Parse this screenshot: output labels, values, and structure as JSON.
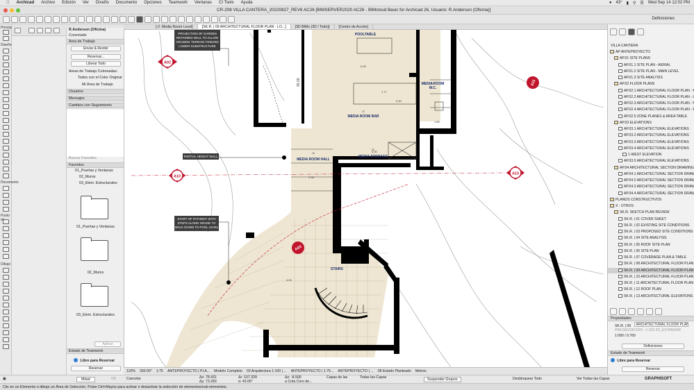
{
  "menubar": {
    "app": "Archicad",
    "items": [
      "Archivo",
      "Edición",
      "Ver",
      "Diseño",
      "Documento",
      "Opciones",
      "Teamwork",
      "Ventanas",
      "CI Tools",
      "Ayuda"
    ],
    "temp": "43°",
    "clock": "Wed Sep 14  12:02 PM"
  },
  "window": {
    "title": "CR-208 VILLA CANTERA_20220827_REV6 AC26 [BIMSERVER2020 AC26 - BIMcloud Basic for Archicad 26, Usuario: R.Anderson (Oficina)]"
  },
  "toolbar": {
    "definiciones": "Definiciones"
  },
  "toolbox": {
    "label_top": "Principal:",
    "label_design": "Diseño",
    "label_doc": "Documento",
    "label_punto": "Punto de",
    "label_dibujo": "Dibujo"
  },
  "tabs": [
    "[-2. Media Room Level]",
    "[SK.R. | 09 ARCHITECTURAL FLOOR PLAN - LO...]",
    "[3D BIMx (3D / Todo)]",
    "[Centro de Acción]"
  ],
  "teamwork": {
    "user": "R.Anderson (Oficina)",
    "connected": "Conectado",
    "area_trabajo": "Área de Trabajo",
    "send_receive": "Enviar & Recibir",
    "reserve": "Reservar...",
    "release_all": "Liberar Todo",
    "colored_areas": "Áreas de Trabajo Coloreadas:",
    "all_original": "Todos con el Color Original",
    "my_area": "Mi Área de Trabajo",
    "users": "Usuarios",
    "messages": "Mensajes",
    "changes": "Cambios con Seguimiento",
    "search": "Buscar Favoritos",
    "favorites": "Favoritos",
    "fav_items": [
      "01_Puertas y Ventanas",
      "02_Muros",
      "03_Elem. Estructurales"
    ],
    "folders": [
      "01_Puertas y Ventanas",
      "02_Muros",
      "03_Elem. Estructurales"
    ],
    "apply": "Aplicar",
    "status_head": "Estado de Teamwork",
    "free": "Libre para Reservar",
    "reserve_btn": "Reservar"
  },
  "plan": {
    "notes": [
      "PROJECTION OF GARDEN RETAINING WALL TO ALLOW GRADING TERRAIN TOWARD LOWER SUBSTRUCTURE",
      "PARTIAL HEIGHT WALL",
      "START OF PATHWAY WITH STEPS ALONG GRADE TO WALK DOWN TO POOL LEVEL"
    ],
    "rooms": [
      {
        "label": "POOLTABLE"
      },
      {
        "number": "20",
        "label": "MEDIA ROOM BAR"
      },
      {
        "number": "21",
        "label": "MEDIA ROOM",
        "sub": "W.C."
      },
      {
        "number": "26",
        "label": "MEDIA ROOM HALL"
      },
      {
        "number": "25",
        "label": "MEDIA STORAGE"
      },
      {
        "label": "STAIRS"
      }
    ],
    "section_markers": [
      "A02",
      "A11",
      "A10",
      "A10",
      "A03"
    ],
    "dims": [
      "6.25",
      "45.00",
      "1.77",
      "0.20",
      "1.80",
      "3.00",
      "2.36",
      "4.00"
    ]
  },
  "navigator": {
    "project": "VILLA CANTERA",
    "items": [
      {
        "t": "AP ANTEPROYECTO",
        "l": 0,
        "k": "folder"
      },
      {
        "t": "AP.01 SITE PLANS",
        "l": 1,
        "k": "folder"
      },
      {
        "t": "AP.01.1 SITE PLAN - AERIAL",
        "l": 2,
        "k": "view"
      },
      {
        "t": "AP.01.2 SITE PLAN - MAIN LEVEL",
        "l": 2,
        "k": "view"
      },
      {
        "t": "AP.01.3 SITE ANALYSIS",
        "l": 2,
        "k": "view"
      },
      {
        "t": "AP.02 FLOOR PLANS",
        "l": 1,
        "k": "folder"
      },
      {
        "t": "AP.02.1 ARCHITECTURAL FLOOR PLAN - MAIN LEVEL",
        "l": 2,
        "k": "view"
      },
      {
        "t": "AP.02.2 ARCHITECTURAL FLOOR PLAN - LOWER LEV",
        "l": 2,
        "k": "view"
      },
      {
        "t": "AP.02.3 ARCHITECTURAL FLOOR PLAN - MEDIA ROOM",
        "l": 2,
        "k": "view"
      },
      {
        "t": "AP.02.4 ARCHITECTURAL FLOOR PLAN - POOL & FAC",
        "l": 2,
        "k": "view"
      },
      {
        "t": "AP.02.5 ZONE PLANES & AREA TABLE",
        "l": 2,
        "k": "view"
      },
      {
        "t": "AP.03 ELEVATIONS",
        "l": 1,
        "k": "folder"
      },
      {
        "t": "AP.03.1 ARCHITECTURAL ELEVATIONS",
        "l": 2,
        "k": "view"
      },
      {
        "t": "AP.03.2 ARCHITECTURAL ELEVATIONS",
        "l": 2,
        "k": "view"
      },
      {
        "t": "AP.03.3 ARCHITECTURAL ELEVATIONS",
        "l": 2,
        "k": "view"
      },
      {
        "t": "AP.03.4 ARCHITECTURAL ELEVATIONS",
        "l": 2,
        "k": "view"
      },
      {
        "t": "1-WEST ELEVATION",
        "l": 3,
        "k": "view"
      },
      {
        "t": "AP.03.5 ARCHITECTURAL ELEVATIONS",
        "l": 2,
        "k": "view"
      },
      {
        "t": "AP.04 ARCHITECTURAL SECTION DRAWINGS",
        "l": 1,
        "k": "folder"
      },
      {
        "t": "AP.04.1 ARCHITECTURAL SECTION DRAWINGS",
        "l": 2,
        "k": "view"
      },
      {
        "t": "AP.04.2 ARCHITECTURAL SECTION DRAWINGS",
        "l": 2,
        "k": "view"
      },
      {
        "t": "AP.04.3 ARCHITECTURAL SECTION DRAWINGS",
        "l": 2,
        "k": "view"
      },
      {
        "t": "AP.04.4 ARCHITECTURAL SECTION DRAWINGS",
        "l": 2,
        "k": "view"
      },
      {
        "t": "PLANOS CONSTRUCTIVOS",
        "l": 0,
        "k": "folder"
      },
      {
        "t": "X - OTROS",
        "l": 0,
        "k": "folder"
      },
      {
        "t": "SK.R. SKETCH PLAN REVIEW",
        "l": 1,
        "k": "folder"
      },
      {
        "t": "SK.R. | 01 COVER SHEET",
        "l": 2,
        "k": "view"
      },
      {
        "t": "SK.R. | 02 EXISTING SITE CONDITIONS",
        "l": 2,
        "k": "view"
      },
      {
        "t": "SK.R. | 03 PROPOSED SITE CONDITIONS",
        "l": 2,
        "k": "view"
      },
      {
        "t": "SK.R. | 04 SITE ANALYSIS",
        "l": 2,
        "k": "view"
      },
      {
        "t": "SK.R. | 05 ROOF SITE PLAN",
        "l": 2,
        "k": "view"
      },
      {
        "t": "SK.R. | 06 SITE PLAN",
        "l": 2,
        "k": "view"
      },
      {
        "t": "SK.R. | 07 COVERAGE PLAN & TABLE",
        "l": 2,
        "k": "view"
      },
      {
        "t": "SK.R. | 08 ARCHITECTURAL FLOOR PLAN - MAIN LE",
        "l": 2,
        "k": "view"
      },
      {
        "t": "SK.R. | 09 ARCHITECTURAL FLOOR PLAN - LOWER",
        "l": 2,
        "k": "view",
        "sel": true
      },
      {
        "t": "SK.R. | 10 ARCHITECTURAL FLOOR PLAN - MEDIA",
        "l": 2,
        "k": "view"
      },
      {
        "t": "SK.R. | 11 ARCHITECTURAL FLOOR PLAN - POOL &",
        "l": 2,
        "k": "view"
      },
      {
        "t": "SK.R. | 12 ROOF PLAN",
        "l": 2,
        "k": "view"
      },
      {
        "t": "SK.R. | 13 ARCHITECTURAL ELEVATIONS",
        "l": 2,
        "k": "view"
      }
    ],
    "props_head": "Propiedades",
    "prop_id": "SK.R. | 09",
    "prop_name": "ARCHITECTURAL FLOOR PLAN - LOW...",
    "prop_ghost": "PRESENTACIÓN - 1:100 2D_ESTANDAR",
    "prop_scale": "1:090 / 0.760",
    "definitions": "Definiciones",
    "tw_head": "Estado de Teamwork",
    "free": "Libre para Reservar",
    "reserve": "Reservar"
  },
  "quickbar": [
    "110%",
    "330.00°",
    "1:75",
    "ANTEPROYECTO | PLA...",
    "Modelo Completo",
    "03 Arquitectura 1:100 | ...",
    "ANTEPROYECTO | 1:75...",
    "ANTEPROYECTO | ...",
    "08 Estado Planteado",
    "Metros"
  ],
  "coords": {
    "mitad": "Mitad",
    "ok": "OK",
    "cancel": "Cancelar",
    "ax": "Δx: 78.431",
    "ay": "Δy: 73.283",
    "ar": "Δr: 107.339",
    "aa": "α: 43.06°",
    "az": "Δz: -8.500",
    "zref": "a Cota Cero de...",
    "layers": "Capas de las",
    "all_layers": "Todas las Capas",
    "suspend": "Suspender Grupos",
    "unlock": "Desbloquear Todo",
    "show_layers": "Ver Todas las Capas",
    "brand": "GRAPHISOFT"
  },
  "status": "Clic en un Elemento o dibuje un Área de Selección. Pulse Ctrl+Mayús para activar o desactivar la selección de elementos/sub-elementos.",
  "colors": {
    "section_red": "#c0142c",
    "room_fill": "#eee6d2",
    "wall": "#000000"
  }
}
